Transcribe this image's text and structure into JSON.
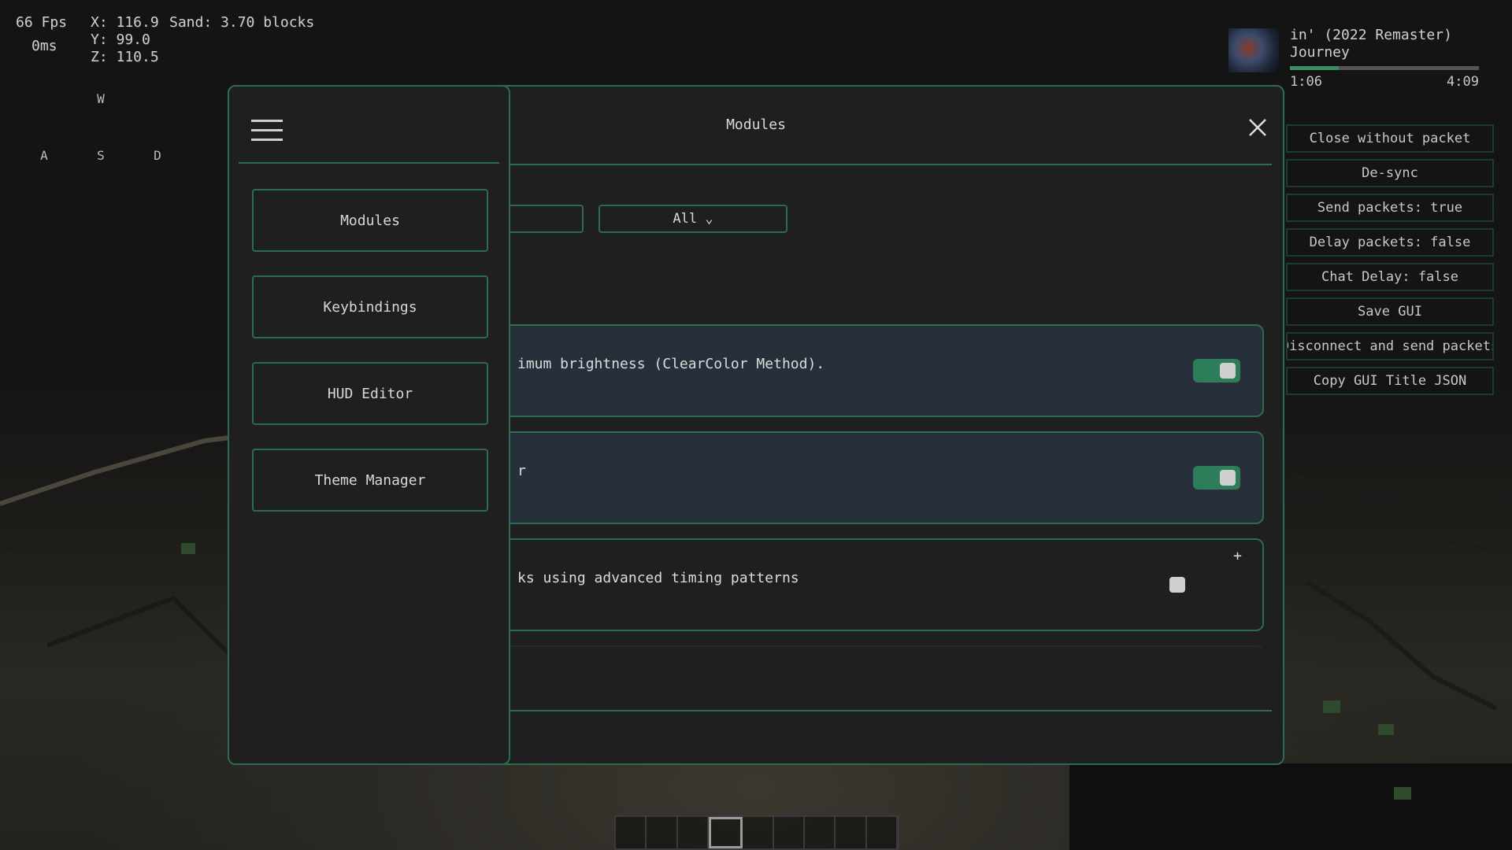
{
  "hud": {
    "fps": "66 Fps",
    "ping": "0ms",
    "x": "X: 116.9",
    "y": "Y: 99.0",
    "z": "Z: 110.5",
    "sand": "Sand: 3.70 blocks",
    "keys": {
      "w": "W",
      "a": "A",
      "s": "S",
      "d": "D"
    }
  },
  "music": {
    "song": "in' (2022 Remaster)",
    "artist": "Journey",
    "elapsed": "1:06",
    "duration": "4:09",
    "progress": 0.26
  },
  "side_buttons": [
    "Close without packet",
    "De-sync",
    "Send packets: true",
    "Delay packets: false",
    "Chat Delay: false",
    "Save GUI",
    "Disconnect and send packets",
    "Copy GUI Title JSON"
  ],
  "panel": {
    "title": "Modules",
    "filter_label": "All ⌄",
    "modules": [
      {
        "desc": "imum brightness (ClearColor Method).",
        "enabled": true
      },
      {
        "desc": "r",
        "enabled": true
      },
      {
        "desc": "ks using advanced timing patterns",
        "enabled": false,
        "expand": "+"
      }
    ]
  },
  "sidebar": {
    "items": [
      "Modules",
      "Keybindings",
      "HUD Editor",
      "Theme Manager"
    ]
  },
  "hotbar": {
    "slots": 9,
    "selected": 4
  },
  "colors": {
    "accent": "#2d6b53",
    "toggle_on": "#2d7d5a",
    "panel_bg": "#1f1f1f",
    "card_enabled_bg": "#27303a"
  }
}
